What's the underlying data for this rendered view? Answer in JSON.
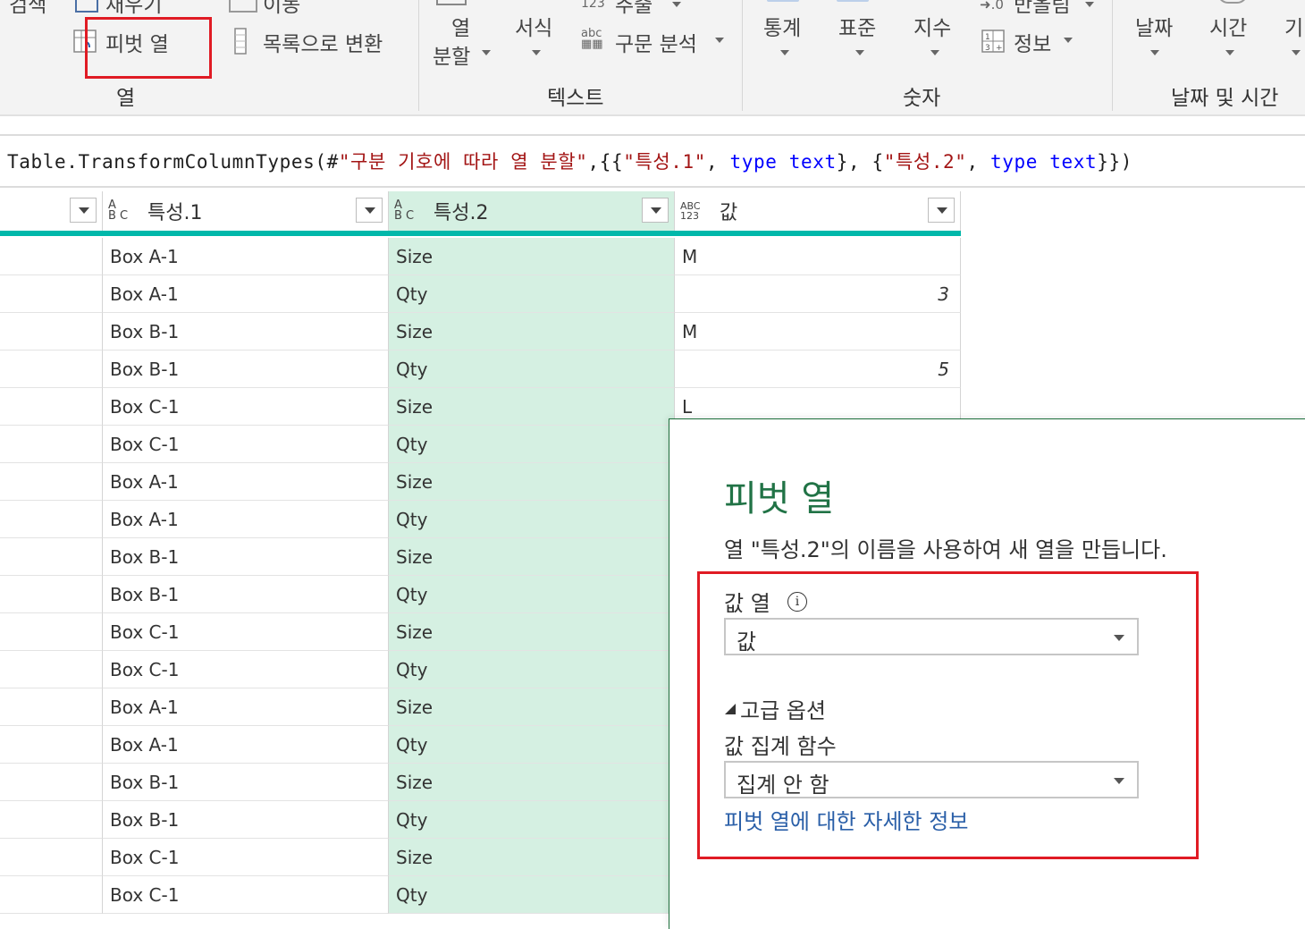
{
  "ribbon": {
    "col_group": {
      "partial_search": "검색",
      "fill": "채우기",
      "move": "이동",
      "pivot_column": "피벗 열",
      "convert_to_list": "목록으로 변환",
      "group_label": "열"
    },
    "text_group": {
      "split_column_line1": "열",
      "split_column_line2": "분할",
      "format": "서식",
      "extract": "추출",
      "parse": "구문 분석",
      "group_label": "텍스트"
    },
    "number_group": {
      "statistics": "통계",
      "standard": "표준",
      "scientific": "지수",
      "rounding": "반올림",
      "information": "정보",
      "group_label": "숫자"
    },
    "datetime_group": {
      "date": "날짜",
      "time": "시간",
      "duration_partial": "기",
      "group_label": "날짜 및 시간"
    }
  },
  "formula_bar": {
    "p1": "Table.TransformColumnTypes(#",
    "s1": "\"구분 기호에 따라 열 분할\"",
    "p2": ",{{",
    "s2": "\"특성.1\"",
    "p3": ", ",
    "k1": "type",
    "p4": " ",
    "k2": "text",
    "p5": "}, {",
    "s3": "\"특성.2\"",
    "p6": ", ",
    "k3": "type",
    "p7": " ",
    "k4": "text",
    "p8": "}})"
  },
  "table": {
    "columns": [
      {
        "name": "특성.1",
        "type_icon_top": "A",
        "type_icon_bottom": "B C"
      },
      {
        "name": "특성.2",
        "type_icon_top": "A",
        "type_icon_bottom": "B C"
      },
      {
        "name": "값",
        "type_icon_top": "ABC",
        "type_icon_bottom": "123"
      }
    ],
    "rows": [
      {
        "c1": "Box A-1",
        "c2": "Size",
        "c3": "M"
      },
      {
        "c1": "Box A-1",
        "c2": "Qty",
        "c3": "3"
      },
      {
        "c1": "Box B-1",
        "c2": "Size",
        "c3": "M"
      },
      {
        "c1": "Box B-1",
        "c2": "Qty",
        "c3": "5"
      },
      {
        "c1": "Box C-1",
        "c2": "Size",
        "c3": "L"
      },
      {
        "c1": "Box C-1",
        "c2": "Qty",
        "c3": ""
      },
      {
        "c1": "Box A-1",
        "c2": "Size",
        "c3": ""
      },
      {
        "c1": "Box A-1",
        "c2": "Qty",
        "c3": ""
      },
      {
        "c1": "Box B-1",
        "c2": "Size",
        "c3": ""
      },
      {
        "c1": "Box B-1",
        "c2": "Qty",
        "c3": ""
      },
      {
        "c1": "Box C-1",
        "c2": "Size",
        "c3": ""
      },
      {
        "c1": "Box C-1",
        "c2": "Qty",
        "c3": ""
      },
      {
        "c1": "Box A-1",
        "c2": "Size",
        "c3": ""
      },
      {
        "c1": "Box A-1",
        "c2": "Qty",
        "c3": ""
      },
      {
        "c1": "Box B-1",
        "c2": "Size",
        "c3": ""
      },
      {
        "c1": "Box B-1",
        "c2": "Qty",
        "c3": ""
      },
      {
        "c1": "Box C-1",
        "c2": "Size",
        "c3": ""
      },
      {
        "c1": "Box C-1",
        "c2": "Qty",
        "c3": ""
      }
    ]
  },
  "dialog": {
    "title": "피벗 열",
    "description": "열 \"특성.2\"의 이름을 사용하여 새 열을 만듭니다.",
    "values_column_label": "값 열",
    "info_glyph": "i",
    "values_column_value": "값",
    "advanced_options": "고급 옵션",
    "aggregate_label": "값 집계 함수",
    "aggregate_value": "집계 안 함",
    "learn_more": "피벗 열에 대한 자세한 정보"
  },
  "colors": {
    "accent_green": "#217346",
    "selected_column": "#d5f0e2",
    "header_bar": "#01b8aa",
    "highlight_red": "#e01b24",
    "link_blue": "#2a5fa8"
  }
}
